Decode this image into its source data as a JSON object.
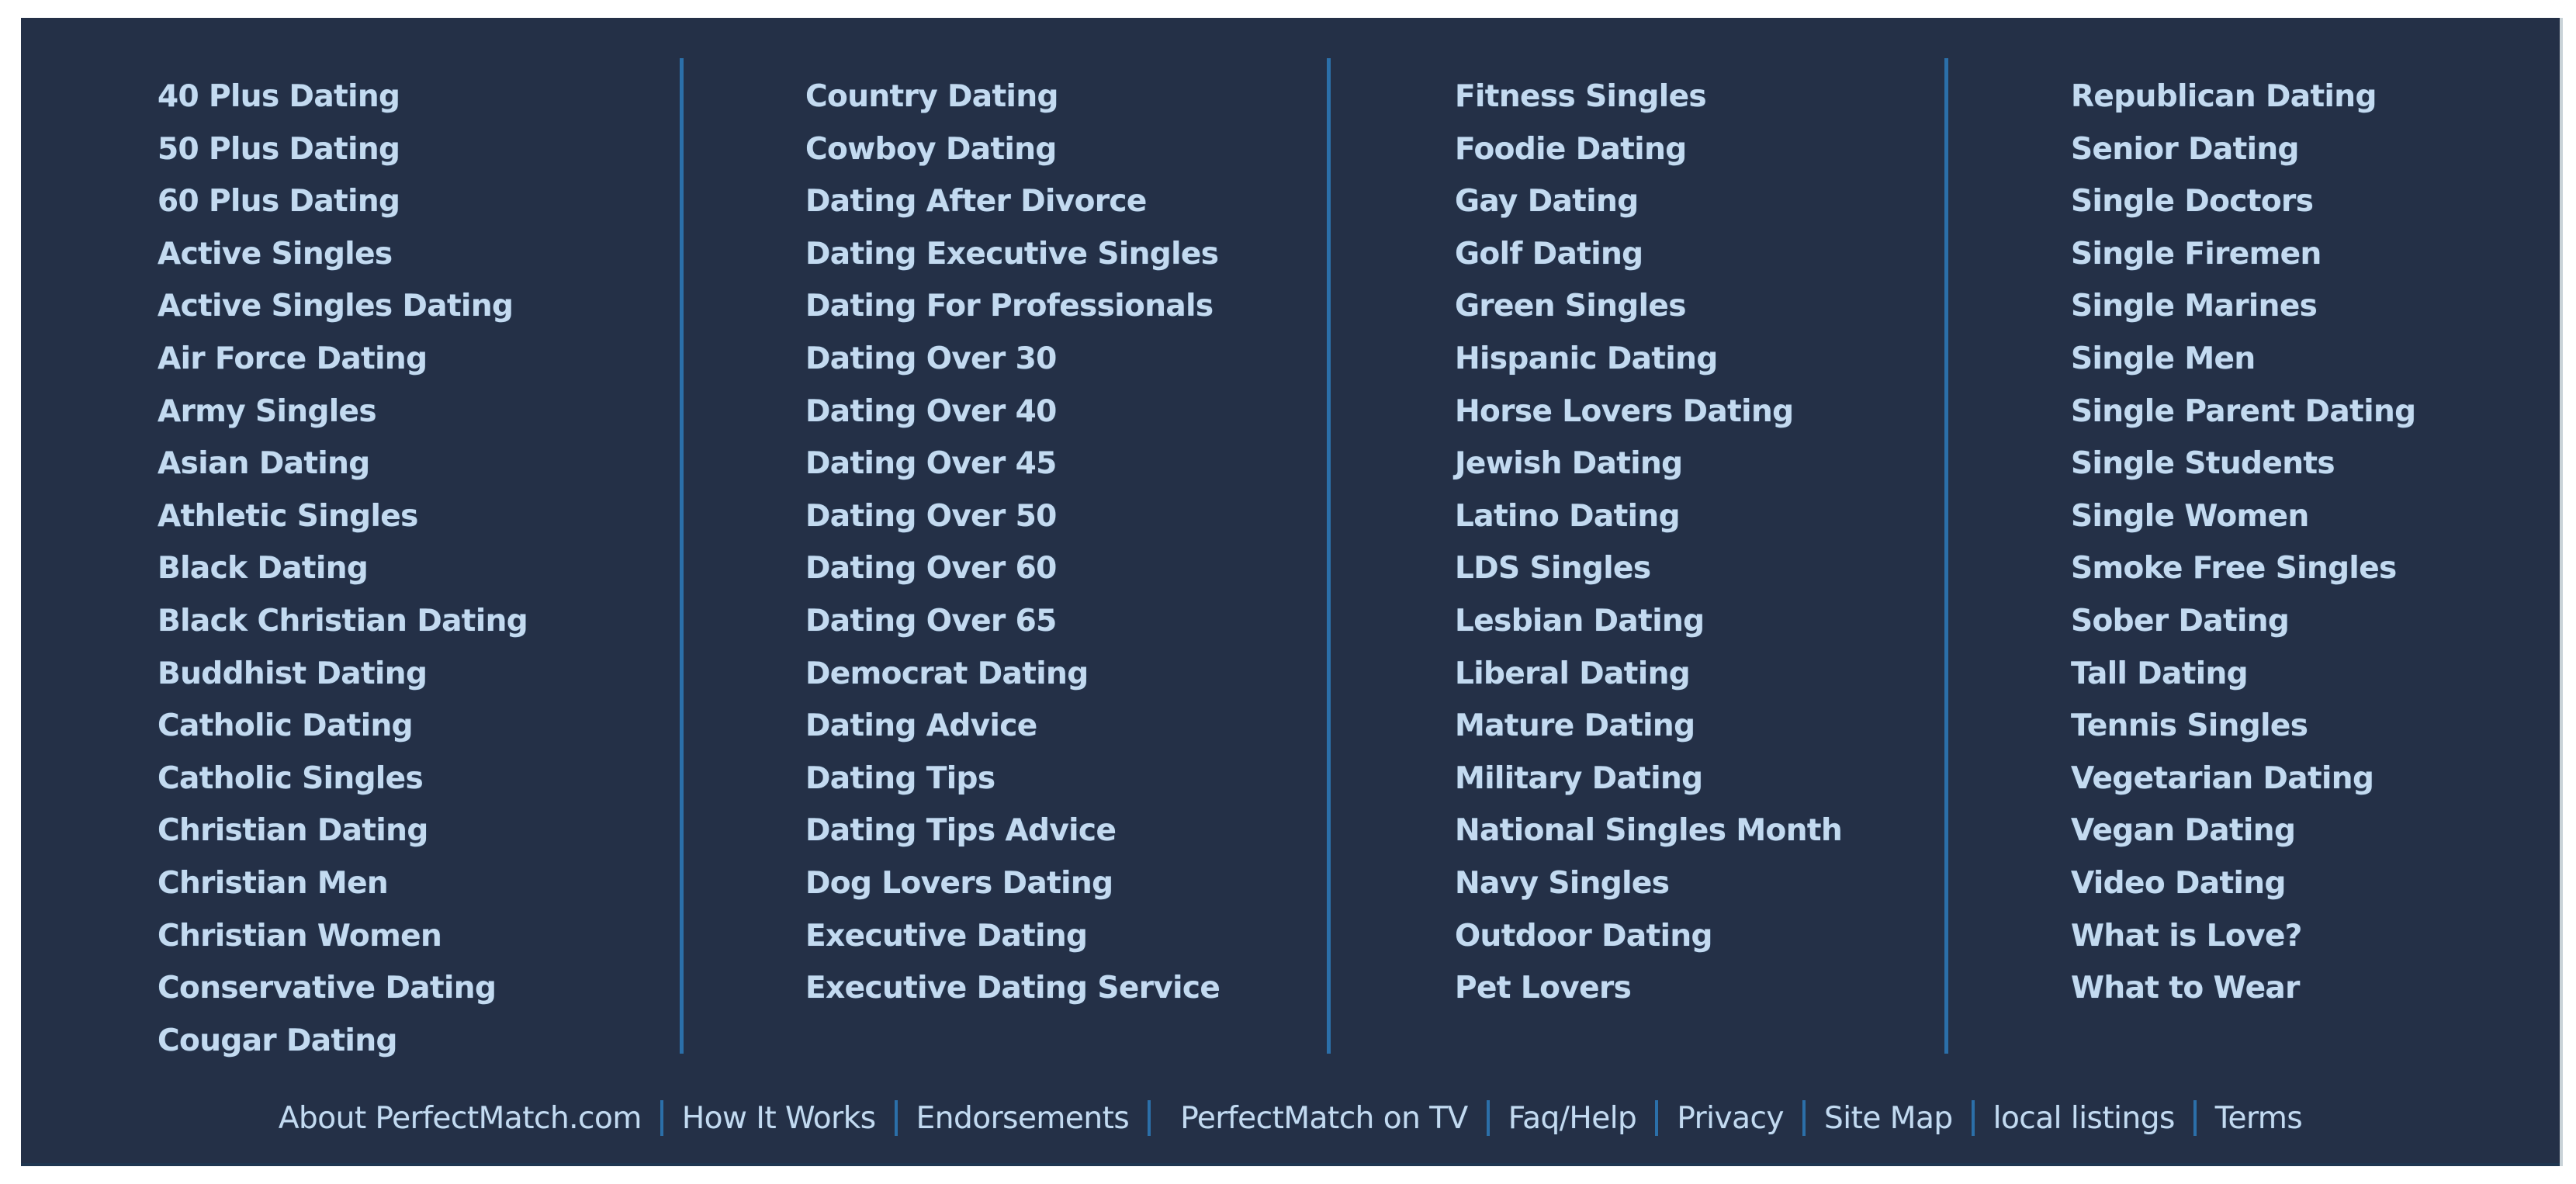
{
  "colors": {
    "panel_background": "#243047",
    "link_text": "#c3daf0",
    "divider": "#2b6fa9",
    "page_background": "#ffffff"
  },
  "columns": [
    {
      "links": [
        "40 Plus Dating",
        "50 Plus Dating",
        "60 Plus Dating",
        "Active Singles",
        "Active Singles Dating",
        "Air Force Dating",
        "Army Singles",
        "Asian Dating",
        "Athletic Singles",
        "Black Dating",
        "Black Christian Dating",
        "Buddhist Dating",
        "Catholic Dating",
        "Catholic Singles",
        "Christian Dating",
        "Christian Men",
        "Christian Women",
        "Conservative Dating",
        "Cougar Dating"
      ]
    },
    {
      "links": [
        "Country Dating",
        "Cowboy Dating",
        "Dating After Divorce",
        "Dating Executive Singles",
        "Dating For Professionals",
        "Dating Over 30",
        "Dating Over 40",
        "Dating Over 45",
        "Dating Over 50",
        "Dating Over 60",
        "Dating Over 65",
        "Democrat Dating",
        "Dating Advice",
        "Dating Tips",
        "Dating Tips Advice",
        "Dog Lovers Dating",
        "Executive Dating",
        "Executive Dating Service"
      ]
    },
    {
      "links": [
        "Fitness Singles",
        "Foodie Dating",
        "Gay Dating",
        "Golf Dating",
        "Green Singles",
        "Hispanic Dating",
        "Horse Lovers Dating",
        "Jewish Dating",
        "Latino Dating",
        "LDS Singles",
        "Lesbian Dating",
        "Liberal Dating",
        "Mature Dating",
        "Military Dating",
        "National Singles Month",
        "Navy Singles",
        "Outdoor Dating",
        "Pet Lovers"
      ]
    },
    {
      "links": [
        "Republican Dating",
        "Senior Dating",
        "Single Doctors",
        "Single Firemen",
        "Single Marines",
        "Single Men",
        "Single Parent Dating",
        "Single Students",
        "Single Women",
        "Smoke Free Singles",
        "Sober Dating",
        "Tall Dating",
        "Tennis Singles",
        "Vegetarian Dating",
        "Vegan Dating",
        "Video Dating",
        "What is Love?",
        "What to Wear"
      ]
    }
  ],
  "footer": {
    "links": [
      "About PerfectMatch.com",
      "How It Works",
      "Endorsements",
      "PerfectMatch on TV",
      "Faq/Help",
      "Privacy",
      "Site Map",
      "local listings",
      "Terms"
    ]
  }
}
